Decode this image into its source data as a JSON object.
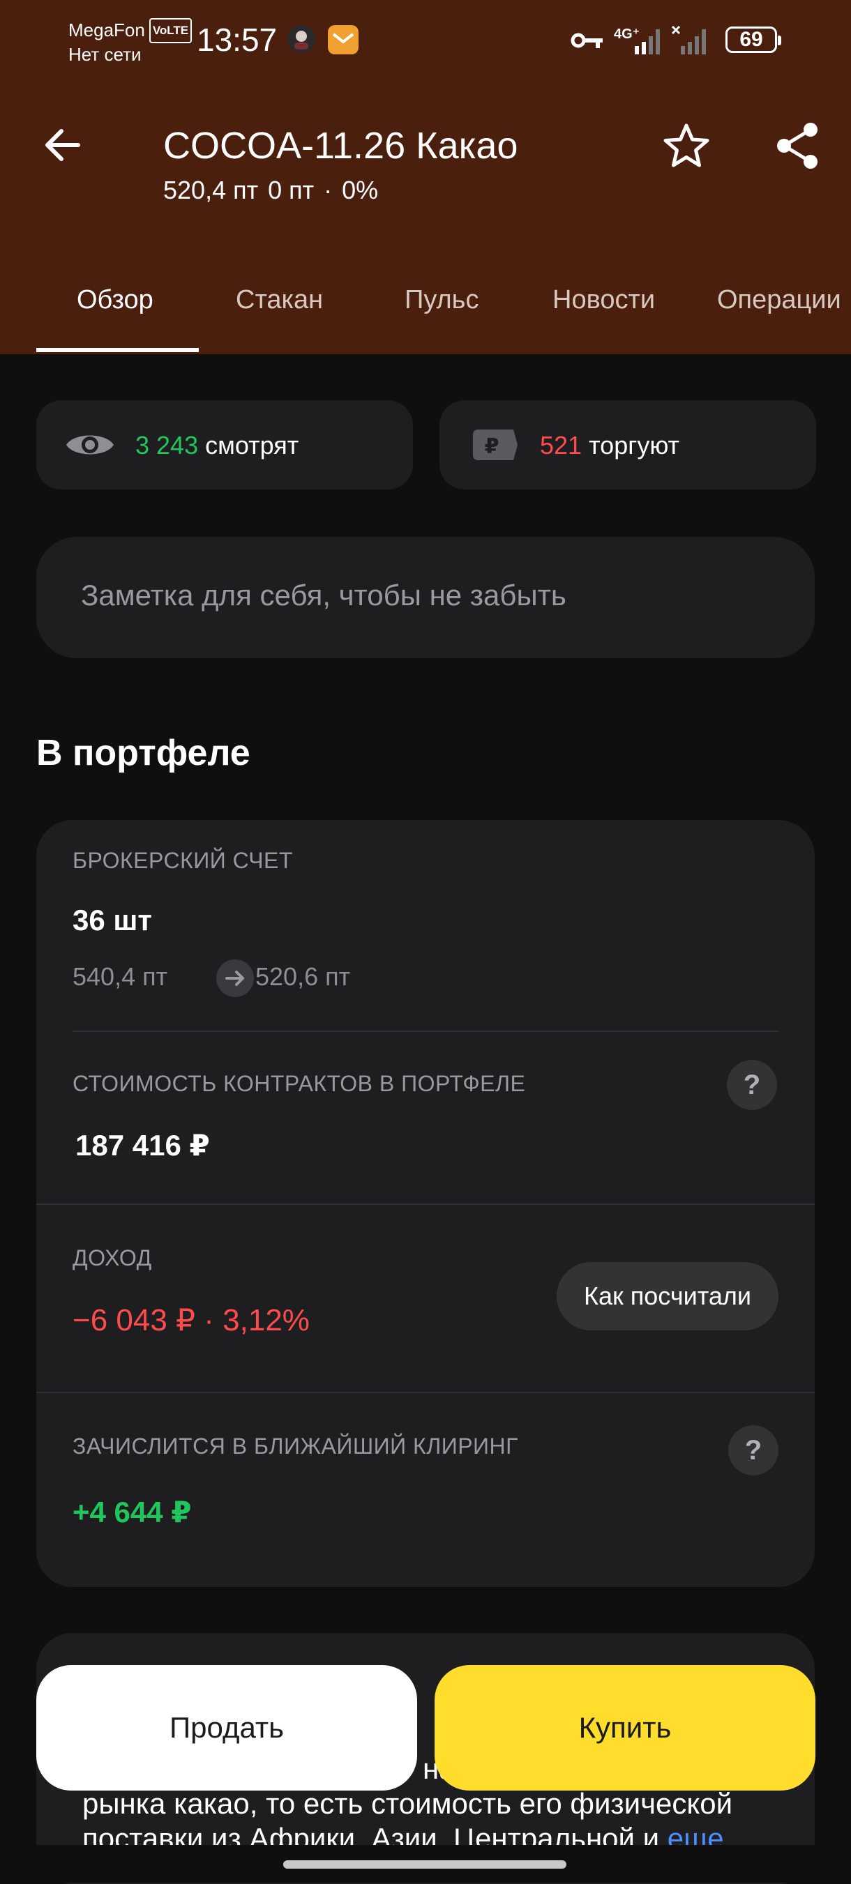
{
  "status_bar": {
    "carrier": "MegaFon",
    "volte": "VoLTE",
    "network_status": "Нет сети",
    "time": "13:57",
    "network_type": "4G⁺",
    "battery": "69"
  },
  "header": {
    "title": "COCOA-11.26 Какао",
    "price": "520,4 пт",
    "change_abs": "0 пт",
    "separator": "·",
    "change_pct": "0%"
  },
  "tabs": [
    {
      "label": "Обзор",
      "active": true
    },
    {
      "label": "Стакан"
    },
    {
      "label": "Пульс"
    },
    {
      "label": "Новости"
    },
    {
      "label": "Операции"
    }
  ],
  "chips": {
    "watching_count": "3 243",
    "watching_label": "смотрят",
    "trading_count": "521",
    "trading_label": "торгуют"
  },
  "note": {
    "placeholder": "Заметка для себя, чтобы не забыть"
  },
  "portfolio": {
    "section_title": "В портфеле",
    "account_caption": "БРОКЕРСКИЙ СЧЕТ",
    "quantity": "36 шт",
    "avg_price": "540,4 пт",
    "current_price": "520,6 пт",
    "value_caption": "СТОИМОСТЬ КОНТРАКТОВ В ПОРТФЕЛЕ",
    "value": "187 416 ₽",
    "income_caption": "ДОХОД",
    "income_abs": "−6 043 ₽",
    "income_sep": "·",
    "income_pct": "3,12%",
    "how_button": "Как посчитали",
    "clearing_caption": "ЗАЧИСЛИТСЯ В БЛИЖАЙШИЙ КЛИРИНГ",
    "clearing_value": "+4 644 ₽",
    "help_glyph": "?"
  },
  "description": {
    "line1": "на",
    "line2": "рынка какао, то есть стоимость его физической",
    "line3": "поставки из Африки, Азии, Центральной и",
    "more": "еще"
  },
  "actions": {
    "sell": "Продать",
    "buy": "Купить"
  },
  "colors": {
    "header_bg": "#4a1f0e",
    "positive": "#21c55d",
    "negative": "#ff4b4b",
    "buy_button": "#ffdd2d",
    "link": "#4c8dff"
  }
}
